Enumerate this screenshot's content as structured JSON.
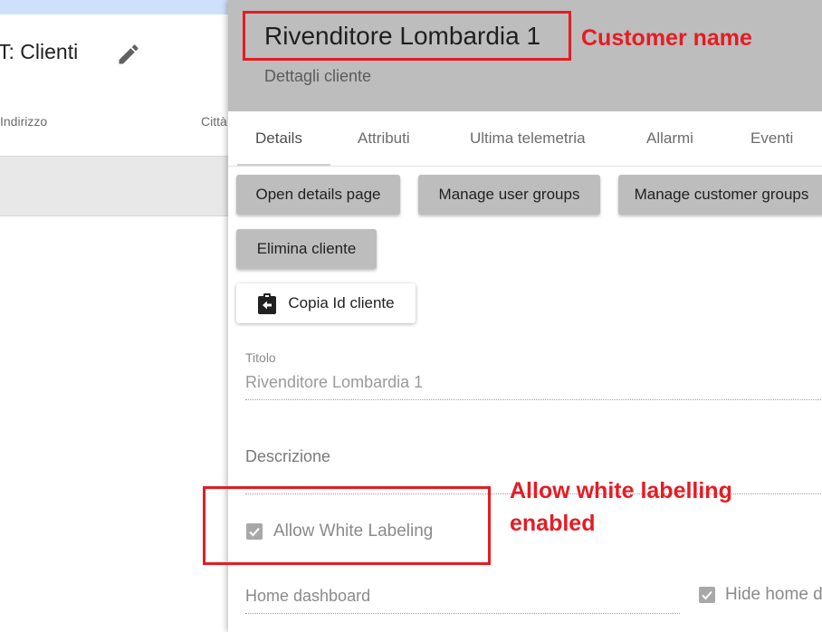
{
  "background": {
    "page_title": "T: Clienti",
    "columns": [
      "Indirizzo",
      "Città"
    ]
  },
  "panel": {
    "customer_name": "Rivenditore Lombardia 1",
    "subtitle": "Dettagli cliente",
    "tabs": [
      {
        "label": "Details",
        "active": true
      },
      {
        "label": "Attributi"
      },
      {
        "label": "Ultima telemetria"
      },
      {
        "label": "Allarmi"
      },
      {
        "label": "Eventi"
      }
    ],
    "buttons": {
      "open_details": "Open details page",
      "manage_user_groups": "Manage user groups",
      "manage_customer_groups": "Manage customer groups",
      "delete_customer": "Elimina cliente",
      "copy_id": "Copia Id cliente"
    },
    "form": {
      "title_label": "Titolo",
      "title_value": "Rivenditore Lombardia 1",
      "description_label": "Descrizione",
      "allow_white_labeling": "Allow White Labeling",
      "allow_white_labeling_checked": true,
      "home_dashboard_label": "Home dashboard",
      "hide_home": "Hide home d",
      "hide_home_checked": true
    }
  },
  "annotations": {
    "customer_name": "Customer name",
    "white_label_line1": "Allow white labelling",
    "white_label_line2": "enabled",
    "color": "#e51c23"
  }
}
